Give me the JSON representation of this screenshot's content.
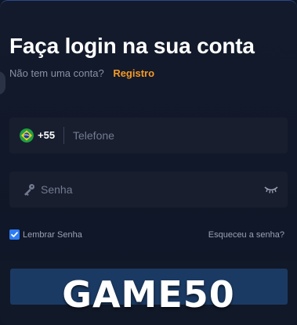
{
  "login": {
    "title": "Faça login na sua conta",
    "no_account_text": "Não tem uma conta?",
    "register_link": "Registro"
  },
  "phone": {
    "flag_icon": "brazil-flag-icon",
    "country_code": "+55",
    "placeholder": "Telefone",
    "value": ""
  },
  "password": {
    "key_icon": "key-icon",
    "placeholder": "Senha",
    "value": "",
    "toggle_icon": "eye-closed-icon"
  },
  "options": {
    "remember_label": "Lembrar Senha",
    "remember_checked": true,
    "forgot_link": "Esqueceu a senha?"
  },
  "promo": {
    "code": "GAME50"
  },
  "colors": {
    "accent": "#f59a23",
    "checkbox": "#2d7cf6",
    "background": "#131a2c",
    "field": "#181e2e",
    "button": "#1b3a63"
  }
}
